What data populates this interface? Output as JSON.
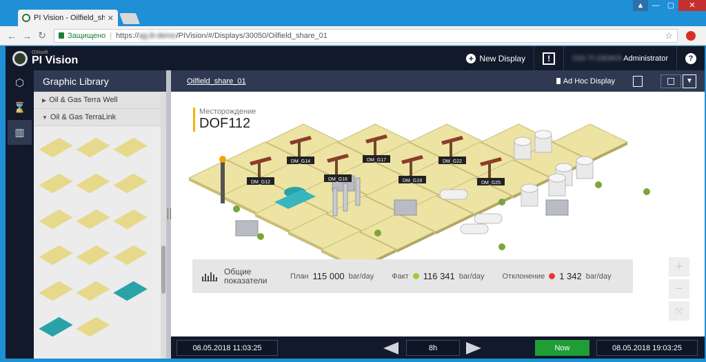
{
  "browser": {
    "tab_title": "PI Vision - Oilfield_share_",
    "tab_close": "✕",
    "secure_label": "Защищено",
    "url_scheme": "https://",
    "url_host": "ag.iti-demo",
    "url_path": "/PIVision/#/Displays/30050/Oilfield_share_01"
  },
  "header": {
    "brand_small": "OSIsoft",
    "brand_big": "PI Vision",
    "new_display_label": "New Display",
    "user_domain": "OSI-TI-DEMO\\",
    "user_name": "Administrator",
    "help_label": "?"
  },
  "library": {
    "title": "Graphic Library",
    "categories": [
      {
        "label": "Oil & Gas Terra Well",
        "expanded": false
      },
      {
        "label": "Oil & Gas TerraLink",
        "expanded": true
      }
    ]
  },
  "display": {
    "name": "Oilfield_share_01",
    "adhoc_label": "Ad Hoc Display",
    "field_label": "Месторождение",
    "field_name": "DOF112",
    "wells": [
      "DM_G12",
      "DM_G14",
      "DM_G16",
      "DM_G17",
      "DM_G19",
      "DM_G22",
      "DM_G25"
    ]
  },
  "kpi": {
    "title_line1": "Общие",
    "title_line2": "показатели",
    "plan_label": "План",
    "plan_value": "115 000",
    "plan_unit": "bar/day",
    "fact_label": "Факт",
    "fact_value": "116 341",
    "fact_unit": "bar/day",
    "fact_color": "#9ccc3a",
    "dev_label": "Отклонение",
    "dev_value": "1 342",
    "dev_unit": "bar/day",
    "dev_color": "#e53935"
  },
  "zoom": {
    "plus": "+",
    "minus": "−"
  },
  "timebar": {
    "start": "08.05.2018 11:03:25",
    "duration": "8h",
    "now_label": "Now",
    "end": "08.05.2018 19:03:25"
  }
}
